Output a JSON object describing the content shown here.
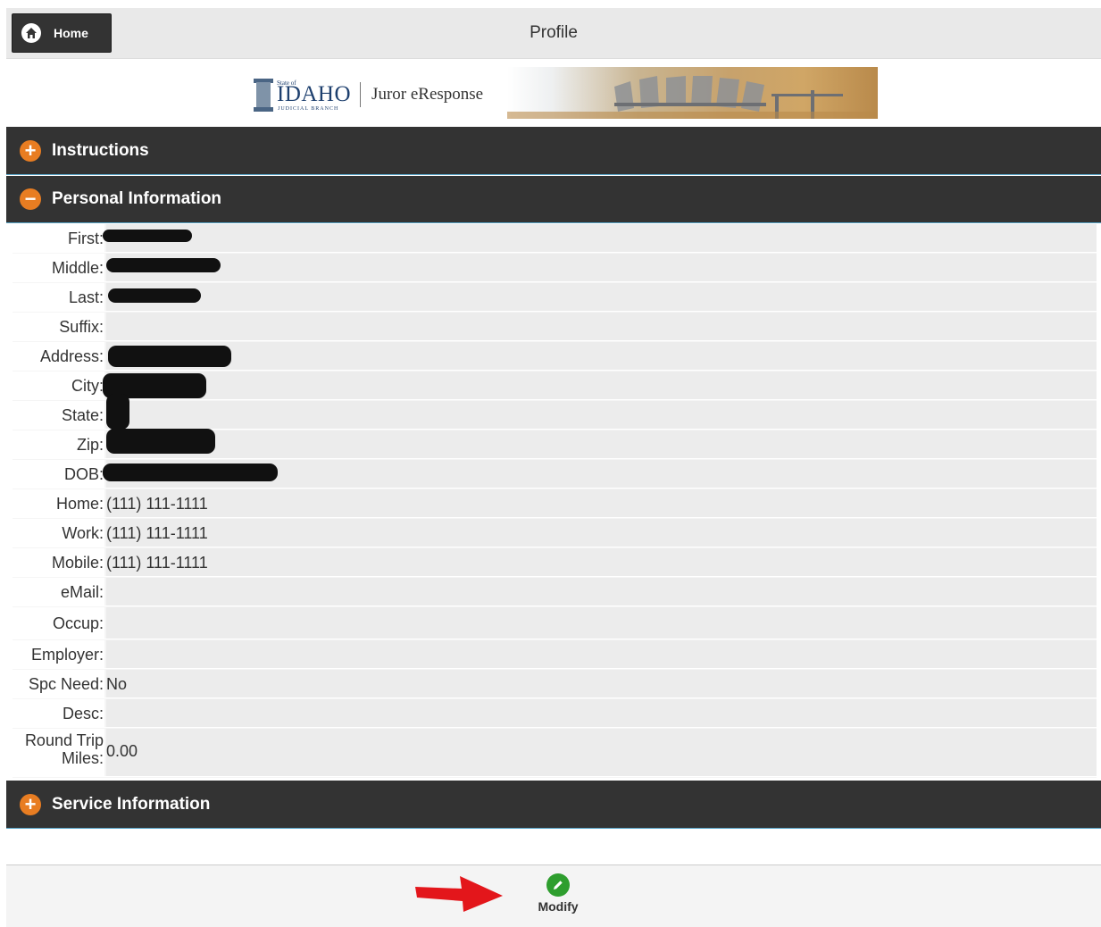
{
  "header": {
    "home_label": "Home",
    "title": "Profile"
  },
  "banner": {
    "state_small": "State of",
    "idaho": "IDAHO",
    "judicial_branch": "JUDICIAL BRANCH",
    "app_name": "Juror eResponse"
  },
  "sections": {
    "instructions": {
      "label": "Instructions",
      "toggle": "+"
    },
    "personal": {
      "label": "Personal Information",
      "toggle": "−"
    },
    "service": {
      "label": "Service Information",
      "toggle": "+"
    }
  },
  "personal_fields": [
    {
      "label": "First:",
      "value": ""
    },
    {
      "label": "Middle:",
      "value": ""
    },
    {
      "label": "Last:",
      "value": ""
    },
    {
      "label": "Suffix:",
      "value": ""
    },
    {
      "label": "Address:",
      "value": ""
    },
    {
      "label": "City:",
      "value": ""
    },
    {
      "label": "State:",
      "value": ""
    },
    {
      "label": "Zip:",
      "value": ""
    },
    {
      "label": "DOB:",
      "value": ""
    },
    {
      "label": "Home:",
      "value": "(111) 111-1111"
    },
    {
      "label": "Work:",
      "value": "(111) 111-1111"
    },
    {
      "label": "Mobile:",
      "value": "(111) 111-1111"
    },
    {
      "label": "eMail:",
      "value": ""
    },
    {
      "label": "Occup:",
      "value": ""
    },
    {
      "label": "Employer:",
      "value": ""
    },
    {
      "label": "Spc Need:",
      "value": "No"
    },
    {
      "label": "Desc:",
      "value": ""
    },
    {
      "label_line1": "Round Trip",
      "label_line2": "Miles:",
      "value": "0.00"
    }
  ],
  "footer": {
    "modify_label": "Modify"
  },
  "colors": {
    "toggle_orange": "#e87d22",
    "section_dark": "#333333",
    "modify_green": "#2e9e2e",
    "arrow_red": "#e3161b"
  }
}
